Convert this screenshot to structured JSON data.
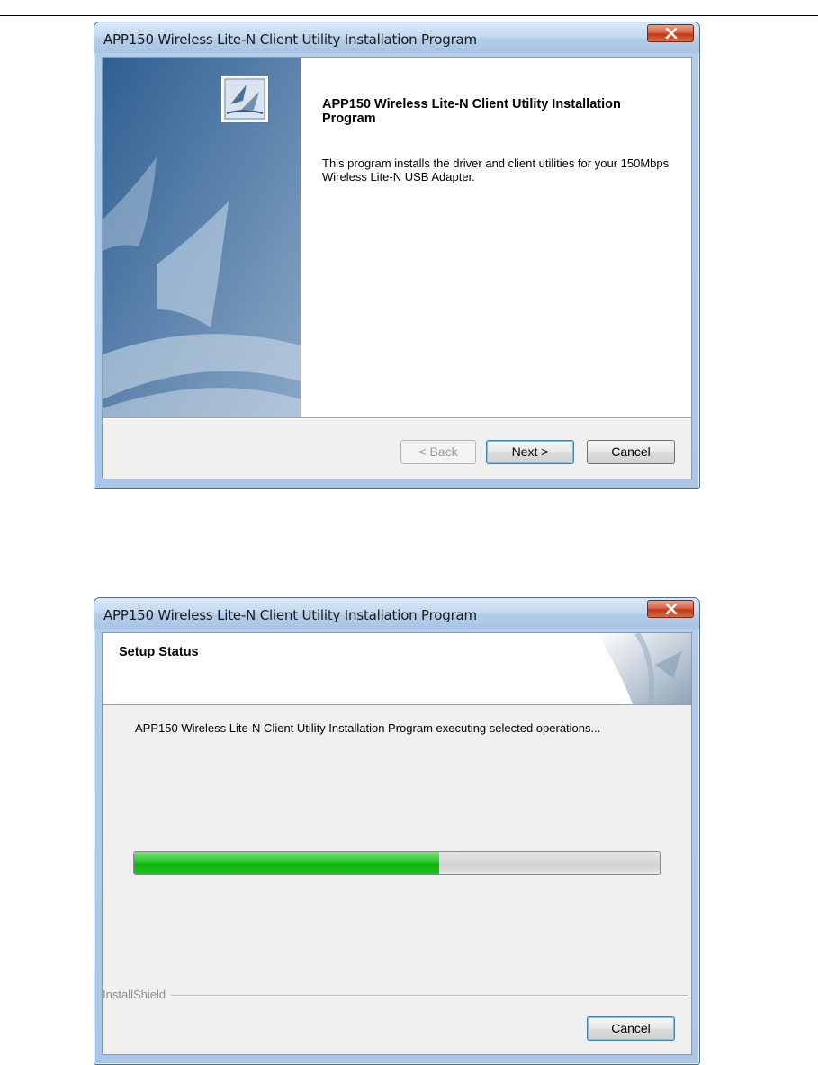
{
  "window1": {
    "title": "APP150 Wireless Lite-N Client Utility Installation Program",
    "heading": "APP150 Wireless Lite-N Client Utility Installation Program",
    "description": "This program installs the driver and client utilities for your 150Mbps Wireless Lite-N USB Adapter.",
    "buttons": {
      "back": "< Back",
      "next": "Next >",
      "cancel": "Cancel"
    }
  },
  "window2": {
    "title": "APP150 Wireless Lite-N Client Utility Installation Program",
    "header": "Setup Status",
    "status": "APP150 Wireless Lite-N Client Utility Installation Program executing selected operations...",
    "progress_fraction": 0.58,
    "group_label": "InstallShield",
    "buttons": {
      "cancel": "Cancel"
    }
  },
  "colors": {
    "titlebar": "#b1cce8",
    "close_button": "#c23b1c",
    "progress_fill": "#19b819",
    "side_panel": "#4f7aa5"
  },
  "icons": [
    "close-icon",
    "setup-logo-icon",
    "installshield-watermark"
  ]
}
